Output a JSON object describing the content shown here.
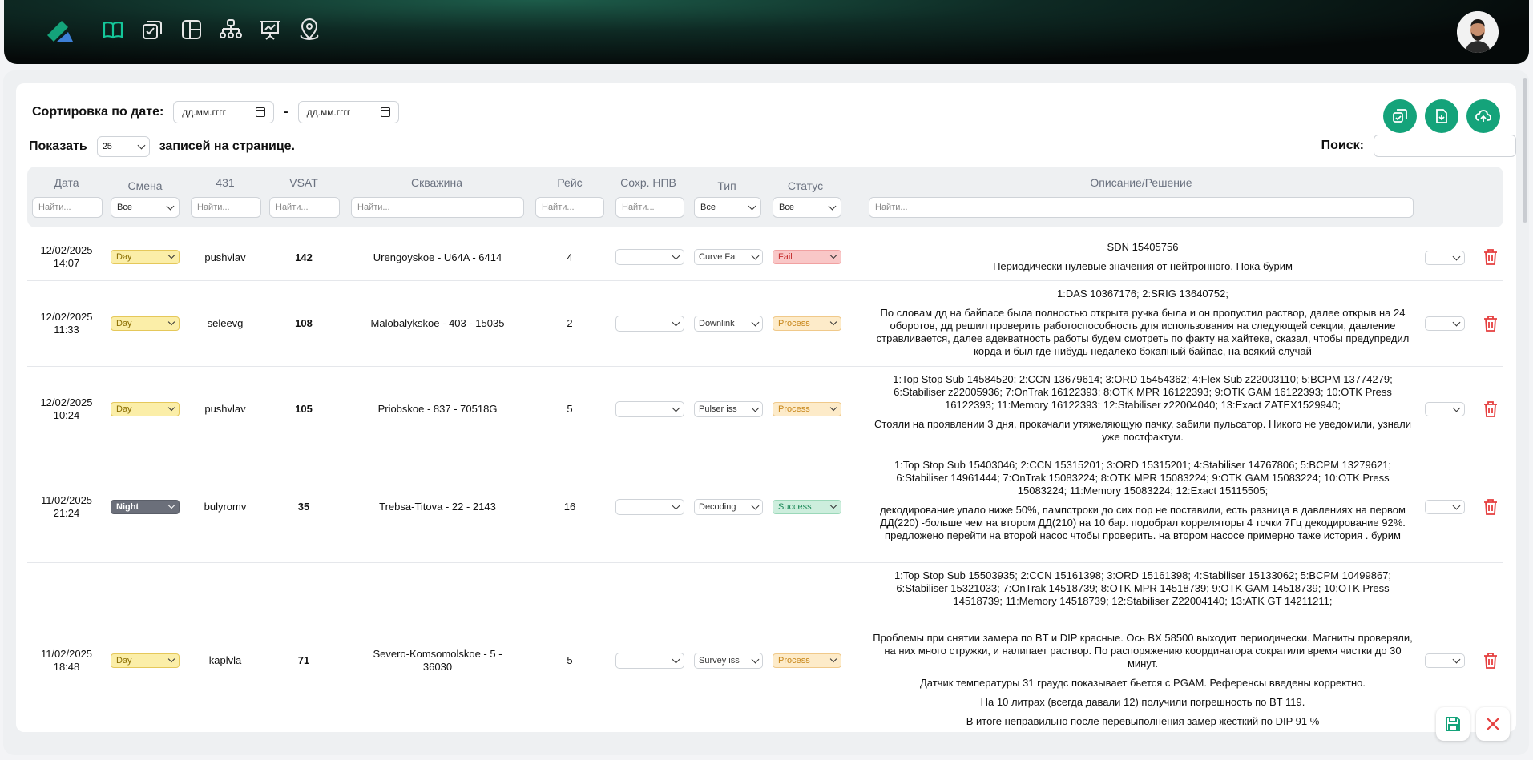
{
  "colors": {
    "accent": "#14a37a",
    "day": "#fbeea8",
    "night": "#6b6f7a",
    "fail": "#f9c7c7",
    "process": "#fdebc9",
    "success": "#cdeedd",
    "delete": "#e53e3e"
  },
  "toolbar": {
    "sort_label": "Сортировка по дате:",
    "date_from": "дд.мм.гггг",
    "dash": "-",
    "date_to": "дд.мм.гггг",
    "show_label": "Показать",
    "page_size": "25",
    "records_label": "записей на странице.",
    "search_label": "Поиск:"
  },
  "columns": {
    "date": "Дата",
    "shift": "Смена",
    "c431": "431",
    "vsat": "VSAT",
    "well": "Скважина",
    "run": "Рейс",
    "npv": "Сохр. НПВ",
    "type": "Тип",
    "status": "Статус",
    "desc": "Описание/Решение"
  },
  "filters": {
    "find": "Найти...",
    "all": "Все"
  },
  "rows": [
    {
      "date": "12/02/2025",
      "time": "14:07",
      "shift": "Day",
      "c431": "pushvlav",
      "vsat": "142",
      "well": "Urengoyskoe - U64A - 6414",
      "run": "4",
      "type": "Curve Fai",
      "status": "Fail",
      "desc1": "SDN 15405756",
      "desc2": "Периодически нулевые значения от нейтронного. Пока бурим"
    },
    {
      "date": "12/02/2025",
      "time": "11:33",
      "shift": "Day",
      "c431": "seleevg",
      "vsat": "108",
      "well": "Malobalykskoe - 403 - 15035",
      "run": "2",
      "type": "Downlink",
      "status": "Process",
      "desc1": "1:DAS 10367176; 2:SRIG 13640752;",
      "desc2": "По словам дд на байпасе была полностью открыта ручка была и он пропустил раствор, далее открыв на 24 оборотов, дд решил проверить работоспособность для использования на следующей секции, давление стравливается, далее адекватность работы будем смотреть по факту на хайтеке, сказал, чтобы предупредил корда и был где-нибудь недалеко бэкапный байпас, на всякий случай"
    },
    {
      "date": "12/02/2025",
      "time": "10:24",
      "shift": "Day",
      "c431": "pushvlav",
      "vsat": "105",
      "well": "Priobskoe - 837 - 70518G",
      "run": "5",
      "type": "Pulser iss",
      "status": "Process",
      "desc1": "1:Top Stop Sub 14584520; 2:CCN 13679614; 3:ORD 15454362; 4:Flex Sub z22003110; 5:BCPM 13774279; 6:Stabiliser z22005936; 7:OnTrak 16122393; 8:OTK MPR 16122393; 9:OTK GAM 16122393; 10:OTK Press 16122393; 11:Memory 16122393; 12:Stabiliser z22004040; 13:Exact ZATEX1529940;",
      "desc2": "Стояли на проявлении 3 дня, прокачали утяжеляющую пачку, забили пульсатор. Никого не уведомили, узнали уже постфактум."
    },
    {
      "date": "11/02/2025",
      "time": "21:24",
      "shift": "Night",
      "c431": "bulyromv",
      "vsat": "35",
      "well": "Trebsa-Titova - 22 - 2143",
      "run": "16",
      "type": "Decoding",
      "status": "Success",
      "desc1": "1:Top Stop Sub 15403046; 2:CCN 15315201; 3:ORD 15315201; 4:Stabiliser 14767806; 5:BCPM 13279621; 6:Stabiliser 14961444; 7:OnTrak 15083224; 8:OTK MPR 15083224; 9:OTK GAM 15083224; 10:OTK Press 15083224; 11:Memory 15083224; 12:Exact 15115505;",
      "desc2": "декодирование упало ниже 50%, пампстроки до сих пор не поставили, есть разница в давлениях на первом ДД(220) -больше чем на втором ДД(210) на 10 бар. подобрал корреляторы 4 точки 7Гц декодирование 92%. предложено перейти на второй насос чтобы проверить. на втором насосе примерно таже история . бурим"
    },
    {
      "date": "11/02/2025",
      "time": "18:48",
      "shift": "Day",
      "c431": "kaplvla",
      "vsat": "71",
      "well": "Severo-Komsomolskoe - 5 - 36030",
      "run": "5",
      "type": "Survey iss",
      "status": "Process",
      "desc1": "1:Top Stop Sub 15503935; 2:CCN 15161398; 3:ORD 15161398; 4:Stabiliser 15133062; 5:BCPM 10499867; 6:Stabiliser 15321033; 7:OnTrak 14518739; 8:OTK MPR 14518739; 9:OTK GAM 14518739; 10:OTK Press 14518739; 11:Memory 14518739; 12:Stabiliser Z22004140; 13:ATK GT 14211211;",
      "desc2": "Проблемы при снятии замера по BT и DIP красные. Ось BX 58500 выходит периодически. Магниты проверяли, на них много стружки, и налипает раствор. По распоряжению координатора сократили время чистки до 30 минут.",
      "desc3": "Датчик температуры 31 граудс показывает бьется с PGAM. Референсы введены корректно.",
      "desc4": "На 10 литрах (всегда давали 12) получили погрешность по BT 119.",
      "desc5": "В итоге неправильно после перевыполнения замер жесткий по DIP 91 %"
    }
  ]
}
